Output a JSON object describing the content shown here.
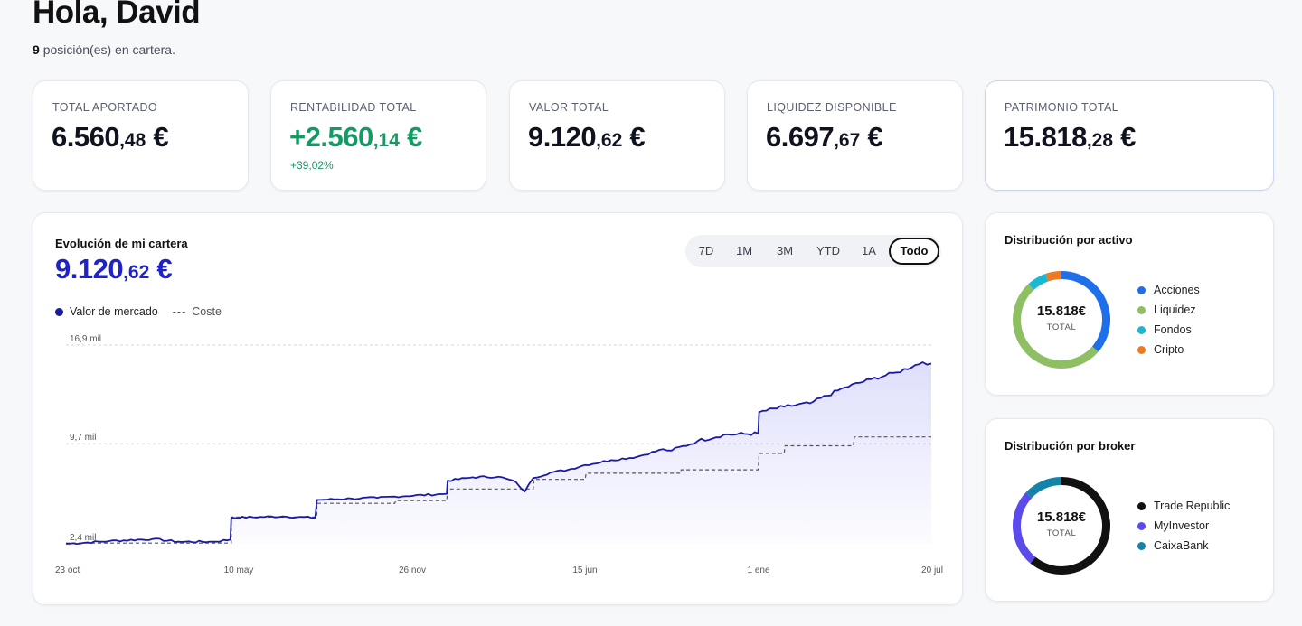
{
  "header": {
    "greeting": "Hola, David",
    "positions_count": "9",
    "positions_text": "posición(es) en cartera."
  },
  "stats": [
    {
      "label": "TOTAL APORTADO",
      "int": "6.560",
      "dec": ",48",
      "currency": " €"
    },
    {
      "label": "RENTABILIDAD TOTAL",
      "int": "+2.560",
      "dec": ",14",
      "currency": " €",
      "change": "+39,02%"
    },
    {
      "label": "VALOR TOTAL",
      "int": "9.120",
      "dec": ",62",
      "currency": " €"
    },
    {
      "label": "LIQUIDEZ DISPONIBLE",
      "int": "6.697",
      "dec": ",67",
      "currency": " €"
    },
    {
      "label": "PATRIMONIO TOTAL",
      "int": "15.818",
      "dec": ",28",
      "currency": " €"
    }
  ],
  "portfolio": {
    "title": "Evolución de mi cartera",
    "value_int": "9.120",
    "value_dec": ",62",
    "currency": " €",
    "ranges": [
      "7D",
      "1M",
      "3M",
      "YTD",
      "1A",
      "Todo"
    ],
    "active_range": "Todo",
    "legend_market": "Valor de mercado",
    "legend_cost_symbol": "---",
    "legend_cost": "Coste"
  },
  "chart_data": {
    "type": "line",
    "x_ticks": [
      "23 oct",
      "10 may",
      "26 nov",
      "15 jun",
      "1 ene",
      "20 jul"
    ],
    "y_ticks": [
      "16,9 mil",
      "9,7 mil",
      "2,4 mil"
    ],
    "y_tick_values": [
      16900,
      9700,
      2400
    ],
    "ylim": [
      2400,
      16900
    ],
    "grid": true,
    "series": [
      {
        "name": "Valor de mercado",
        "color": "#1a1aa6",
        "style": "solid",
        "fill": true,
        "points": [
          [
            0,
            2400
          ],
          [
            0.05,
            2600
          ],
          [
            0.1,
            2750
          ],
          [
            0.13,
            2550
          ],
          [
            0.17,
            2550
          ],
          [
            0.19,
            2700
          ],
          [
            0.191,
            4300
          ],
          [
            0.25,
            4400
          ],
          [
            0.288,
            4300
          ],
          [
            0.29,
            5600
          ],
          [
            0.33,
            5700
          ],
          [
            0.36,
            5750
          ],
          [
            0.38,
            5850
          ],
          [
            0.44,
            6050
          ],
          [
            0.441,
            7000
          ],
          [
            0.47,
            7250
          ],
          [
            0.5,
            7300
          ],
          [
            0.52,
            6900
          ],
          [
            0.53,
            6200
          ],
          [
            0.54,
            7200
          ],
          [
            0.56,
            7600
          ],
          [
            0.58,
            7800
          ],
          [
            0.6,
            8150
          ],
          [
            0.63,
            8500
          ],
          [
            0.66,
            8750
          ],
          [
            0.69,
            9300
          ],
          [
            0.7,
            9200
          ],
          [
            0.73,
            9900
          ],
          [
            0.76,
            10350
          ],
          [
            0.8,
            10450
          ],
          [
            0.801,
            12000
          ],
          [
            0.83,
            12400
          ],
          [
            0.86,
            12650
          ],
          [
            0.9,
            13800
          ],
          [
            0.93,
            14400
          ],
          [
            0.96,
            14900
          ],
          [
            0.99,
            15650
          ],
          [
            1.0,
            15550
          ]
        ]
      },
      {
        "name": "Coste",
        "color": "#555555",
        "style": "dashed",
        "points": [
          [
            0,
            2450
          ],
          [
            0.191,
            2450
          ],
          [
            0.191,
            4350
          ],
          [
            0.29,
            4350
          ],
          [
            0.29,
            5350
          ],
          [
            0.38,
            5350
          ],
          [
            0.381,
            5550
          ],
          [
            0.44,
            5550
          ],
          [
            0.441,
            6400
          ],
          [
            0.54,
            6400
          ],
          [
            0.541,
            7100
          ],
          [
            0.6,
            7100
          ],
          [
            0.601,
            7550
          ],
          [
            0.71,
            7550
          ],
          [
            0.711,
            7800
          ],
          [
            0.8,
            7800
          ],
          [
            0.801,
            9000
          ],
          [
            0.83,
            9000
          ],
          [
            0.831,
            9550
          ],
          [
            0.91,
            9550
          ],
          [
            0.911,
            10200
          ],
          [
            1.0,
            10200
          ]
        ]
      }
    ]
  },
  "dist_asset": {
    "title": "Distribución por activo",
    "total": "15.818€",
    "total_label": "TOTAL",
    "items": [
      {
        "name": "Acciones",
        "color": "#1f6feb",
        "value": 36.4
      },
      {
        "name": "Liquidez",
        "color": "#8fbf63",
        "value": 51.7
      },
      {
        "name": "Fondos",
        "color": "#1bb8d1",
        "value": 6.6
      },
      {
        "name": "Cripto",
        "color": "#f07a21",
        "value": 5.3
      }
    ]
  },
  "dist_broker": {
    "title": "Distribución por broker",
    "total": "15.818€",
    "total_label": "TOTAL",
    "items": [
      {
        "name": "Trade Republic",
        "color": "#111111",
        "value": 61.0
      },
      {
        "name": "MyInvestor",
        "color": "#5b4bea",
        "value": 26.0
      },
      {
        "name": "CaixaBank",
        "color": "#1583a8",
        "value": 13.0
      }
    ]
  }
}
